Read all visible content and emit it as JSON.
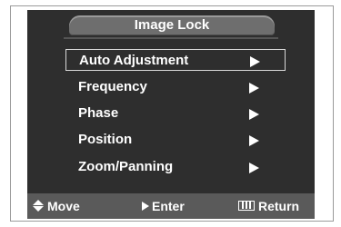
{
  "title": "Image Lock",
  "menu": {
    "items": [
      {
        "label": "Auto Adjustment",
        "arrow_icon": "right-arrow-icon",
        "selected": true
      },
      {
        "label": "Frequency",
        "arrow_icon": "right-arrow-icon",
        "selected": false
      },
      {
        "label": "Phase",
        "arrow_icon": "right-arrow-icon",
        "selected": false
      },
      {
        "label": "Position",
        "arrow_icon": "right-arrow-icon",
        "selected": false
      },
      {
        "label": "Zoom/Panning",
        "arrow_icon": "right-arrow-icon",
        "selected": false
      }
    ]
  },
  "footer": {
    "move": {
      "icon": "up-down-arrows-icon",
      "label": "Move"
    },
    "enter": {
      "icon": "right-triangle-icon",
      "label": "Enter"
    },
    "return": {
      "icon": "menu-return-icon",
      "label": "Return"
    }
  },
  "colors": {
    "osd_background": "#2e2e2e",
    "title_tab": "#6e6e6e",
    "footer_background": "#5a5a5a",
    "text": "#ffffff",
    "selection_border": "#d8d8d8"
  }
}
